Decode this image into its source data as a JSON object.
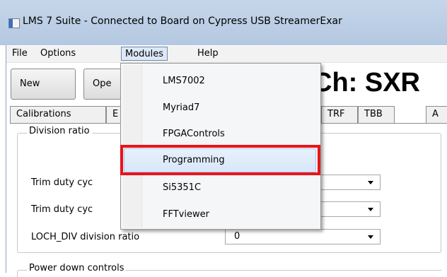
{
  "window": {
    "title": "LMS 7 Suite - Connected to Board on Cypress USB StreamerExar"
  },
  "menubar": {
    "items": [
      "File",
      "Options",
      "Modules",
      "Help"
    ]
  },
  "toolbar": {
    "new_label": "New",
    "open_label": "Ope",
    "channel_label": "Ch: SXR"
  },
  "tabs": [
    "Calibrations",
    "E",
    "TRF",
    "TBB",
    "A"
  ],
  "division_group": {
    "legend": "Division ratio",
    "rows": [
      {
        "label": "Trim duty cyc",
        "value": ""
      },
      {
        "label": "Trim duty cyc",
        "value": ""
      },
      {
        "label": "LOCH_DIV division ratio",
        "value": "0"
      }
    ]
  },
  "power_group": {
    "legend": "Power down controls"
  },
  "modules_menu": {
    "items": [
      "LMS7002",
      "Myriad7",
      "FPGAControls",
      "Programming",
      "Si5351C",
      "FFTviewer"
    ],
    "highlighted": "Programming",
    "annotation_color": "#e8141b"
  }
}
